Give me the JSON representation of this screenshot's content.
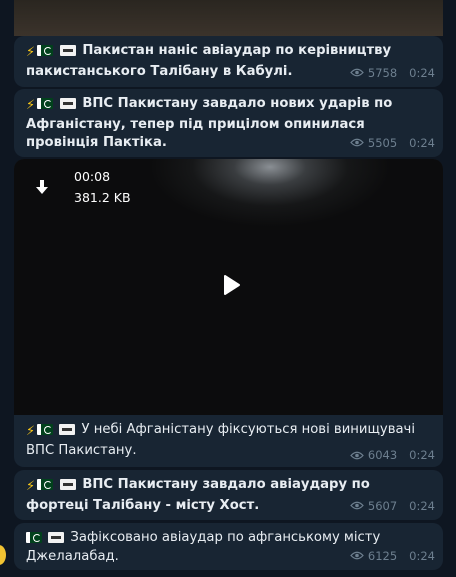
{
  "messages": [
    {
      "text": "Пакистан наніс авіаудар по керівництву пакистанського Талібану в Кабулі.",
      "bold": true,
      "views": "5758",
      "time": "0:24"
    },
    {
      "text": "ВПС Пакистану завдало нових ударів по Афганістану, тепер під прицілом опинилася провінція Пактіка.",
      "bold": true,
      "views": "5505",
      "time": "0:24"
    },
    {
      "video": {
        "duration": "00:08",
        "size": "381.2 KB"
      },
      "text": "У небі Афганістану фіксуються нові винищувачі ВПС Пакистану.",
      "bold": false,
      "views": "6043",
      "time": "0:24"
    },
    {
      "text": "ВПС Пакистану завдало авіаудару по фортеці Талібану - місту Хост.",
      "bold": true,
      "views": "5607",
      "time": "0:24"
    },
    {
      "text": "Зафіксовано авіаудар по афганському місту Джелалабад.",
      "bold": false,
      "views": "6125",
      "time": "0:24"
    }
  ],
  "icons": {
    "prefix": [
      "lightning-emoji",
      "pakistan-flag-emoji",
      "taliban-flag-emoji"
    ],
    "meta": "eye-icon",
    "video_download": "download-icon",
    "video_play": "play-icon"
  },
  "colors": {
    "background": "#0e1621",
    "bubble": "#182533",
    "meta_text": "#6d7f8f"
  }
}
